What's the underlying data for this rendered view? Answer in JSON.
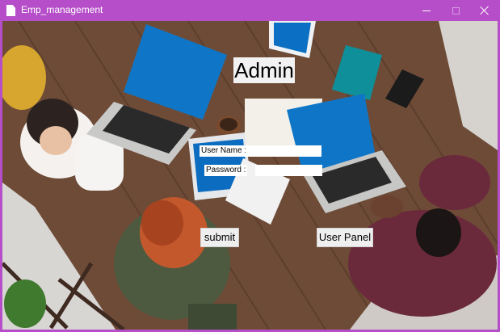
{
  "window": {
    "title": "Emp_management",
    "accent": "#b54ec8",
    "controls": {
      "minimize": "minimize-icon",
      "maximize": "maximize-icon",
      "close": "close-icon"
    }
  },
  "form": {
    "heading": "Admin",
    "username_label": "User Name :",
    "username_value": "",
    "password_label": "Password :",
    "password_value": "",
    "submit_label": "submit",
    "user_panel_label": "User Panel"
  },
  "background": {
    "image_subject": "team at wooden table with laptops"
  }
}
